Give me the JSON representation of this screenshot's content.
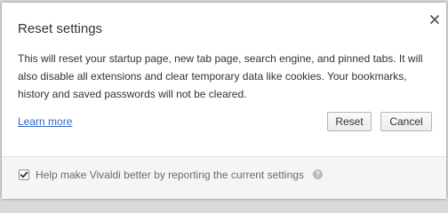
{
  "dialog": {
    "title": "Reset settings",
    "body": "This will reset your startup page, new tab page, search engine, and pinned tabs. It will also disable all extensions and clear temporary data like cookies. Your bookmarks, history and saved passwords will not be cleared.",
    "learn_more": "Learn more",
    "reset_label": "Reset",
    "cancel_label": "Cancel",
    "close_icon": "close-icon"
  },
  "footer": {
    "checkbox_checked": true,
    "label": "Help make Vivaldi better by reporting the current settings",
    "help_icon": "help-icon",
    "help_glyph": "?"
  },
  "colors": {
    "link": "#3366cc",
    "footer_bg": "#f5f5f5",
    "button_border": "#b5b5b5"
  }
}
